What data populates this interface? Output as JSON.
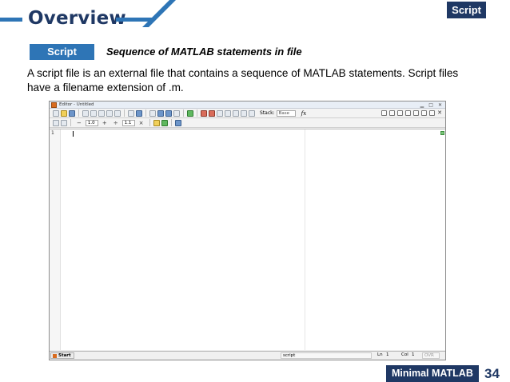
{
  "slide": {
    "title": "Overview",
    "corner_tag": "Script",
    "script_label": "Script",
    "script_description": "Sequence of MATLAB statements in file",
    "body_text": "A script file is an external file that contains a sequence of MATLAB statements. Script files have a filename extension of .m.",
    "footer_tag": "Minimal MATLAB",
    "page_number": "34"
  },
  "editor": {
    "window_title": "Editor - Untitled",
    "stack_label": "Stack:",
    "stack_value": "Base",
    "fx_label": "fx",
    "cell_toolbar": {
      "minus": "−",
      "value_1": "1.0",
      "plus": "+",
      "divide": "÷",
      "value_2": "1.1",
      "times": "×"
    },
    "line_number": "1",
    "status": {
      "start_label": "Start",
      "mode": "script",
      "ln_label": "Ln",
      "ln_value": "1",
      "col_label": "Col",
      "col_value": "1",
      "ovr_label": "OVR"
    }
  },
  "colors": {
    "title": "#1f3864",
    "accent": "#2e75b6",
    "dark_tag": "#1f3864"
  }
}
